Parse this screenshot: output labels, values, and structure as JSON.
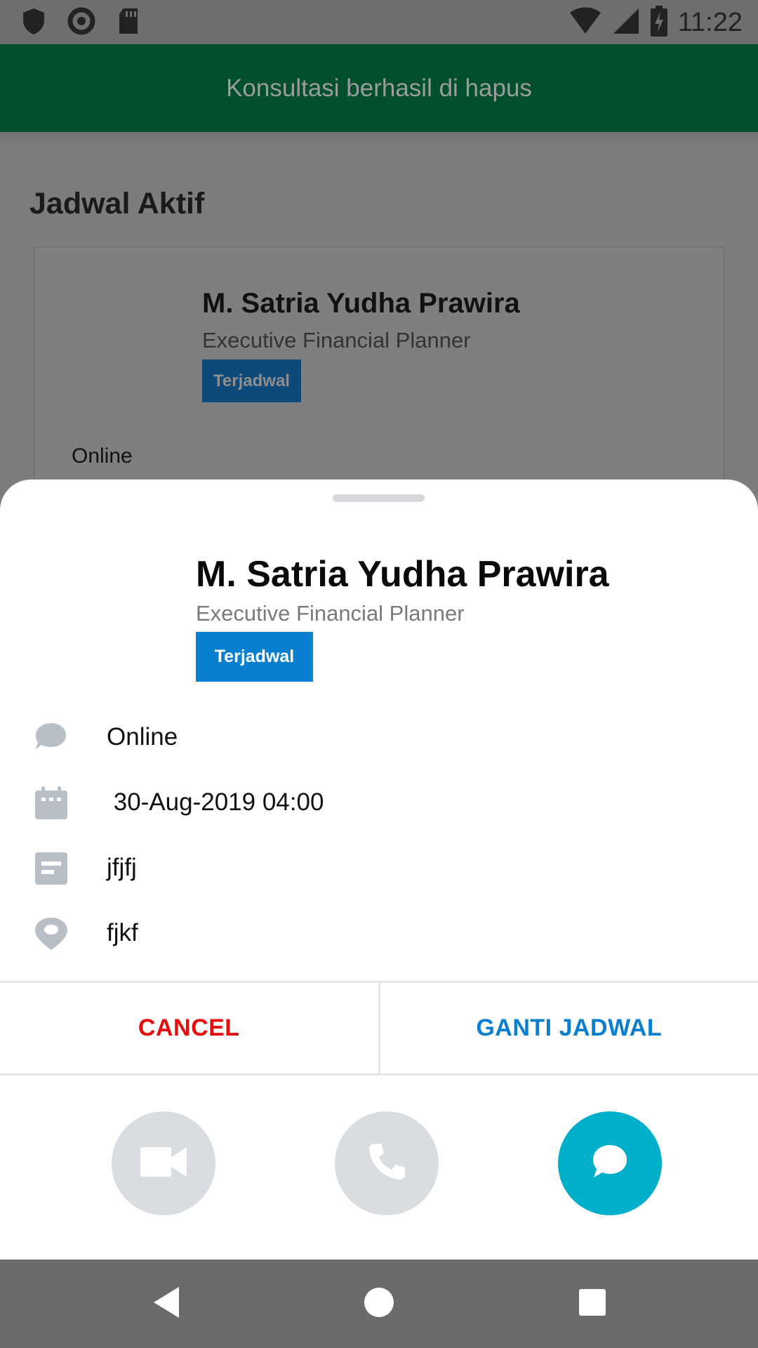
{
  "status_bar": {
    "time": "11:22",
    "icons": [
      "shield-icon",
      "circle-icon",
      "sd-card-icon",
      "wifi-icon",
      "signal-icon",
      "battery-charging-icon"
    ]
  },
  "snackbar": {
    "message": "Konsultasi berhasil di hapus"
  },
  "background": {
    "section_title": "Jadwal Aktif",
    "card": {
      "name": "M. Satria Yudha Prawira",
      "role": "Executive Financial Planner",
      "status": "Terjadwal",
      "type": "Online"
    }
  },
  "sheet": {
    "name": "M. Satria Yudha Prawira",
    "role": "Executive Financial Planner",
    "status_badge": "Terjadwal",
    "details": [
      {
        "icon": "chat-bubble-icon",
        "text": "Online"
      },
      {
        "icon": "calendar-icon",
        "text": " 30-Aug-2019 04:00"
      },
      {
        "icon": "note-icon",
        "text": "jfjfj"
      },
      {
        "icon": "location-icon",
        "text": "fjkf"
      }
    ],
    "cancel_label": "CANCEL",
    "reschedule_label": "GANTI JADWAL",
    "call_buttons": [
      "video-call-icon",
      "phone-call-icon",
      "chat-icon"
    ]
  },
  "colors": {
    "snackbar_bg": "#014f2b",
    "badge_blue": "#0a7fd0",
    "cancel_red": "#e80c0c",
    "chat_active": "#00afc9",
    "call_inactive": "#d9dde1",
    "icon_grey": "#b8bfc6"
  },
  "nav_bar": {
    "icons": [
      "back-icon",
      "home-icon",
      "recents-icon"
    ]
  }
}
